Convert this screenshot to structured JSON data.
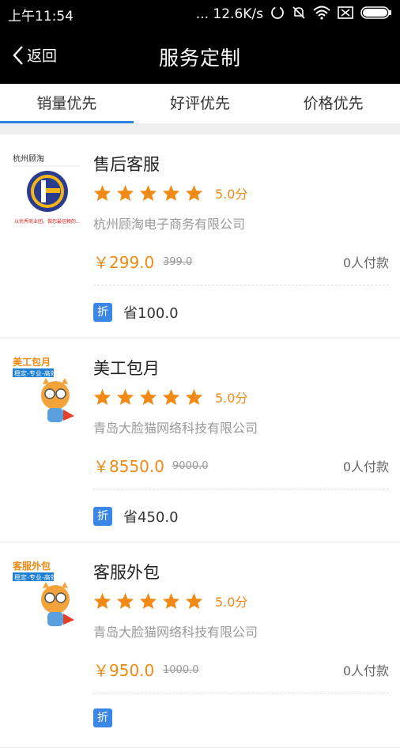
{
  "status": {
    "time": "上午11:54",
    "net": "... 12.6K/s"
  },
  "nav": {
    "back_label": "返回",
    "title": "服务定制"
  },
  "tabs": [
    {
      "label": "销量优先",
      "active": true
    },
    {
      "label": "好评优先",
      "active": false
    },
    {
      "label": "价格优先",
      "active": false
    }
  ],
  "items": [
    {
      "title": "售后客服",
      "rating": "5.0分",
      "company": "杭州顾淘电子商务有限公司",
      "price": "￥299.0",
      "old_price": "399.0",
      "buyers": "0人付款",
      "badge": "折",
      "save": "省100.0",
      "thumb": {
        "kind": "logo",
        "brand": "杭州顾淘",
        "slogan": "以优秀商业团，做您最信赖的..."
      }
    },
    {
      "title": "美工包月",
      "rating": "5.0分",
      "company": "青岛大脸猫网络科技有限公司",
      "price": "￥8550.0",
      "old_price": "9000.0",
      "buyers": "0人付款",
      "badge": "折",
      "save": "省450.0",
      "thumb": {
        "kind": "cat",
        "label": "美工包月",
        "sub": "稳定-专业-高效"
      }
    },
    {
      "title": "客服外包",
      "rating": "5.0分",
      "company": "青岛大脸猫网络科技有限公司",
      "price": "￥950.0",
      "old_price": "1000.0",
      "buyers": "0人付款",
      "badge": "折",
      "save": "",
      "thumb": {
        "kind": "cat",
        "label": "客服外包",
        "sub": "稳定-专业-高效"
      }
    }
  ],
  "colors": {
    "accent": "#f08a14",
    "tab_indicator": "#2f7fe0",
    "badge": "#3b87e6",
    "star": "#f08a14"
  }
}
